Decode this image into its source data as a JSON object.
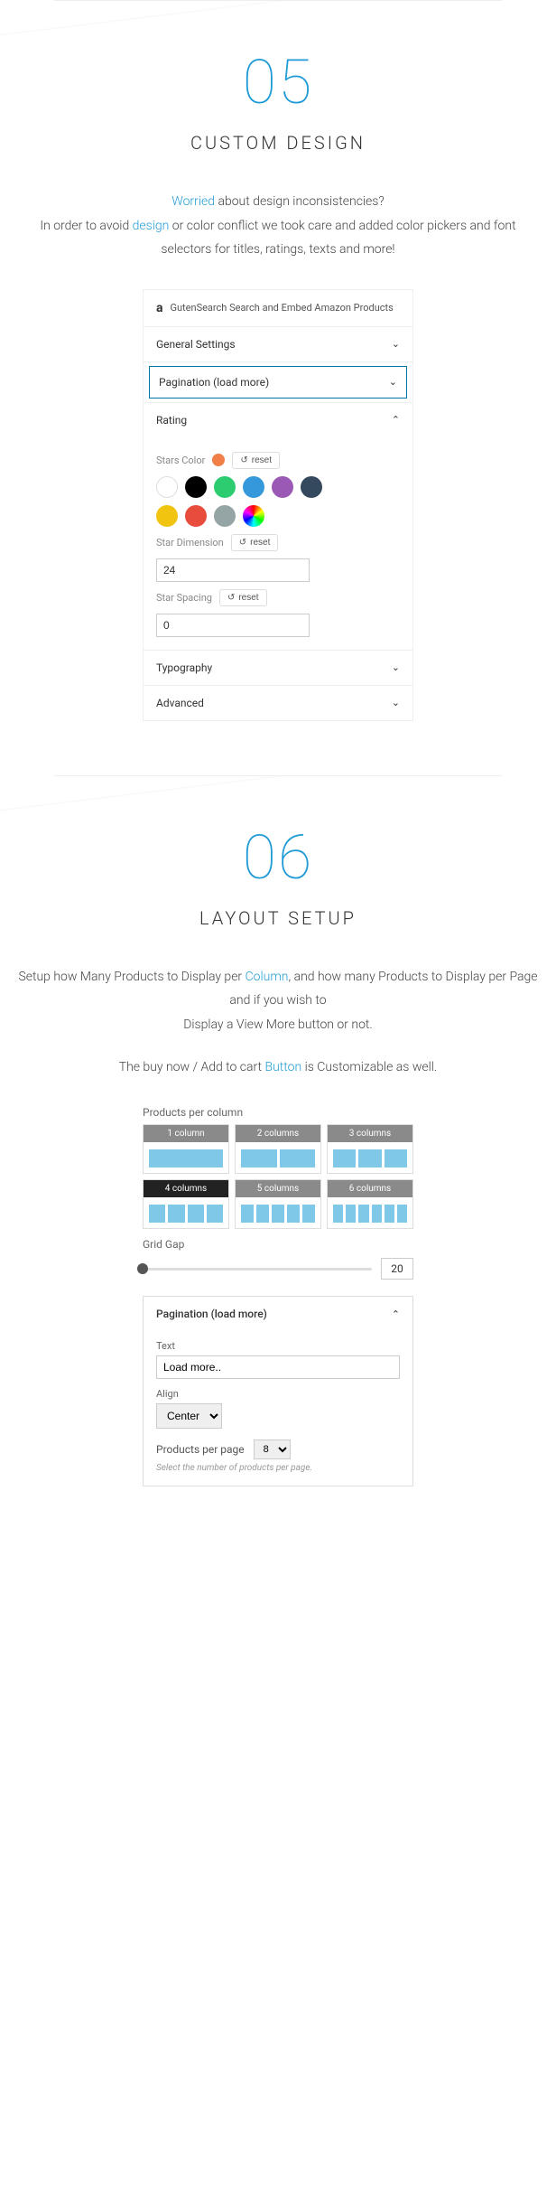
{
  "s5": {
    "num": "05",
    "title": "CUSTOM DESIGN",
    "p1a": "Worried",
    "p1b": " about design inconsistencies?",
    "p2a": "In order to avoid ",
    "p2b": "design",
    "p2c": " or color conflict we took care and added color pickers and font selectors for titles, ratings, texts and more!",
    "panel": {
      "logo": "a",
      "head": "GutenSearch Search and Embed Amazon Products",
      "general": "General Settings",
      "pagination": "Pagination (load more)",
      "rating": "Rating",
      "starsColor": "Stars Color",
      "reset": "reset",
      "starDim": "Star Dimension",
      "starDimVal": "24",
      "starSpacing": "Star Spacing",
      "starSpacingVal": "0",
      "typography": "Typography",
      "advanced": "Advanced"
    }
  },
  "s6": {
    "num": "06",
    "title": "LAYOUT SETUP",
    "p1a": "Setup how Many Products to Display per ",
    "p1b": "Column",
    "p1c": ", and how many Products to Display per Page and if you wish to",
    "p2": "Display a View More button  or not.",
    "p3a": "The buy now / Add to cart ",
    "p3b": "Button",
    "p3c": " is Customizable as well.",
    "panel": {
      "ppc": "Products per column",
      "cols": [
        "1 column",
        "2 columns",
        "3 columns",
        "4 columns",
        "5 columns",
        "6 columns"
      ],
      "gridgap": "Grid Gap",
      "gapval": "20",
      "pagination": "Pagination (load more)",
      "text": "Text",
      "textval": "Load more..",
      "align": "Align",
      "alignval": "Center",
      "ppp": "Products per page",
      "pppval": "8",
      "hint": "Select the number of products per page."
    }
  }
}
